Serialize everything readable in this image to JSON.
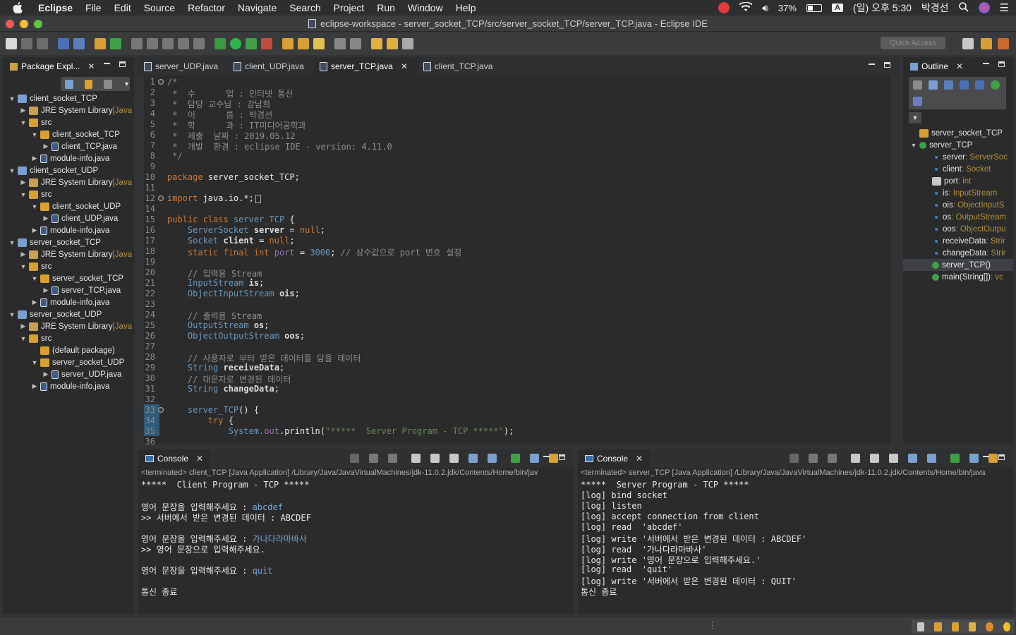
{
  "menubar": {
    "app_name": "Eclipse",
    "items": [
      "File",
      "Edit",
      "Source",
      "Refactor",
      "Navigate",
      "Search",
      "Project",
      "Run",
      "Window",
      "Help"
    ],
    "battery": "37%",
    "input_source": "A",
    "clock": "(일) 오후 5:30",
    "user": "박경선"
  },
  "window": {
    "title": "eclipse-workspace - server_socket_TCP/src/server_socket_TCP/server_TCP.java - Eclipse IDE"
  },
  "toolbar": {
    "quick_access": "Quick Access"
  },
  "package_explorer": {
    "tab_label": "Package Expl...",
    "tree": [
      {
        "label": "client_socket_TCP",
        "suffix": "",
        "arrow": "▼",
        "icon": "project-icon",
        "level": 0
      },
      {
        "label": "JRE System Library",
        "suffix": "[Java",
        "arrow": "▶",
        "icon": "library-icon",
        "level": 1
      },
      {
        "label": "src",
        "suffix": "",
        "arrow": "▼",
        "icon": "src-folder-icon",
        "level": 1
      },
      {
        "label": "client_socket_TCP",
        "suffix": "",
        "arrow": "▼",
        "icon": "package-icon",
        "level": 2
      },
      {
        "label": "client_TCP.java",
        "suffix": "",
        "arrow": "▶",
        "icon": "java-file-icon",
        "level": 3
      },
      {
        "label": "module-info.java",
        "suffix": "",
        "arrow": "▶",
        "icon": "java-file-icon",
        "level": 2
      },
      {
        "label": "client_socket_UDP",
        "suffix": "",
        "arrow": "▼",
        "icon": "project-icon",
        "level": 0
      },
      {
        "label": "JRE System Library",
        "suffix": "[Java",
        "arrow": "▶",
        "icon": "library-icon",
        "level": 1
      },
      {
        "label": "src",
        "suffix": "",
        "arrow": "▼",
        "icon": "src-folder-icon",
        "level": 1
      },
      {
        "label": "client_socket_UDP",
        "suffix": "",
        "arrow": "▼",
        "icon": "package-icon",
        "level": 2
      },
      {
        "label": "client_UDP.java",
        "suffix": "",
        "arrow": "▶",
        "icon": "java-file-icon",
        "level": 3
      },
      {
        "label": "module-info.java",
        "suffix": "",
        "arrow": "▶",
        "icon": "java-file-icon",
        "level": 2
      },
      {
        "label": "server_socket_TCP",
        "suffix": "",
        "arrow": "▼",
        "icon": "project-icon",
        "level": 0
      },
      {
        "label": "JRE System Library",
        "suffix": "[Java",
        "arrow": "▶",
        "icon": "library-icon",
        "level": 1
      },
      {
        "label": "src",
        "suffix": "",
        "arrow": "▼",
        "icon": "src-folder-icon",
        "level": 1
      },
      {
        "label": "server_socket_TCP",
        "suffix": "",
        "arrow": "▼",
        "icon": "package-icon",
        "level": 2
      },
      {
        "label": "server_TCP.java",
        "suffix": "",
        "arrow": "▶",
        "icon": "java-file-icon",
        "level": 3
      },
      {
        "label": "module-info.java",
        "suffix": "",
        "arrow": "▶",
        "icon": "java-file-icon",
        "level": 2
      },
      {
        "label": "server_socket_UDP",
        "suffix": "",
        "arrow": "▼",
        "icon": "project-icon",
        "level": 0
      },
      {
        "label": "JRE System Library",
        "suffix": "[Java",
        "arrow": "▶",
        "icon": "library-icon",
        "level": 1
      },
      {
        "label": "src",
        "suffix": "",
        "arrow": "▼",
        "icon": "src-folder-icon",
        "level": 1
      },
      {
        "label": "(default package)",
        "suffix": "",
        "arrow": "",
        "icon": "package-icon",
        "level": 2
      },
      {
        "label": "server_socket_UDP",
        "suffix": "",
        "arrow": "▼",
        "icon": "package-icon",
        "level": 2
      },
      {
        "label": "server_UDP.java",
        "suffix": "",
        "arrow": "▶",
        "icon": "java-file-icon",
        "level": 3
      },
      {
        "label": "module-info.java",
        "suffix": "",
        "arrow": "▶",
        "icon": "java-file-icon",
        "level": 2
      }
    ]
  },
  "editor": {
    "tabs": [
      "server_UDP.java",
      "client_UDP.java",
      "server_TCP.java",
      "client_TCP.java"
    ],
    "active_tab": 2,
    "lines": [
      {
        "n": "1",
        "fold": true,
        "segs": [
          {
            "c": "cm",
            "t": "/*"
          }
        ]
      },
      {
        "n": "2",
        "segs": [
          {
            "c": "cm",
            "t": " *  수      업 : 인터넷 통신"
          }
        ]
      },
      {
        "n": "3",
        "segs": [
          {
            "c": "cm",
            "t": " *  담당 교수님 : 강남희"
          }
        ]
      },
      {
        "n": "4",
        "segs": [
          {
            "c": "cm",
            "t": " *  이      름 : 박경선"
          }
        ]
      },
      {
        "n": "5",
        "segs": [
          {
            "c": "cm",
            "t": " *  학      과 : IT미디어공학과"
          }
        ]
      },
      {
        "n": "6",
        "segs": [
          {
            "c": "cm",
            "t": " *  제출  날짜 : 2019.05.12"
          }
        ]
      },
      {
        "n": "7",
        "segs": [
          {
            "c": "cm",
            "t": " *  개발  환경 : eclipse IDE - version: 4.11.0"
          }
        ]
      },
      {
        "n": "8",
        "segs": [
          {
            "c": "cm",
            "t": " */"
          }
        ]
      },
      {
        "n": "9",
        "segs": []
      },
      {
        "n": "10",
        "segs": [
          {
            "c": "kw",
            "t": "package "
          },
          {
            "c": "",
            "t": "server_socket_TCP;"
          }
        ]
      },
      {
        "n": "11",
        "segs": []
      },
      {
        "n": "12",
        "fold": true,
        "segs": [
          {
            "c": "kw",
            "t": "import "
          },
          {
            "c": "",
            "t": "java.io.*;"
          }
        ]
      },
      {
        "n": "14",
        "segs": []
      },
      {
        "n": "15",
        "segs": [
          {
            "c": "kw",
            "t": "public class "
          },
          {
            "c": "ty",
            "t": "server_TCP"
          },
          {
            "c": "",
            "t": " {"
          }
        ]
      },
      {
        "n": "16",
        "segs": [
          {
            "c": "ty",
            "t": "    ServerSocket "
          },
          {
            "c": "fdw",
            "t": "server"
          },
          {
            "c": "",
            "t": " = "
          },
          {
            "c": "kw",
            "t": "null"
          },
          {
            "c": "",
            "t": ";"
          }
        ]
      },
      {
        "n": "17",
        "segs": [
          {
            "c": "ty",
            "t": "    Socket "
          },
          {
            "c": "fdw",
            "t": "client"
          },
          {
            "c": "",
            "t": " = "
          },
          {
            "c": "kw",
            "t": "null"
          },
          {
            "c": "",
            "t": ";"
          }
        ]
      },
      {
        "n": "18",
        "segs": [
          {
            "c": "kw",
            "t": "    static final int "
          },
          {
            "c": "fd",
            "t": "port"
          },
          {
            "c": "",
            "t": " = "
          },
          {
            "c": "ty",
            "t": "3000"
          },
          {
            "c": "",
            "t": "; "
          },
          {
            "c": "cm",
            "t": "// 상수값으로 port 번호 설정"
          }
        ]
      },
      {
        "n": "19",
        "segs": []
      },
      {
        "n": "20",
        "segs": [
          {
            "c": "cm",
            "t": "    // 입력용 Stream"
          }
        ]
      },
      {
        "n": "21",
        "segs": [
          {
            "c": "ty",
            "t": "    InputStream "
          },
          {
            "c": "fdw",
            "t": "is"
          },
          {
            "c": "",
            "t": ";"
          }
        ]
      },
      {
        "n": "22",
        "segs": [
          {
            "c": "ty",
            "t": "    ObjectInputStream "
          },
          {
            "c": "fdw",
            "t": "ois"
          },
          {
            "c": "",
            "t": ";"
          }
        ]
      },
      {
        "n": "23",
        "segs": []
      },
      {
        "n": "24",
        "segs": [
          {
            "c": "cm",
            "t": "    // 출력용 Stream"
          }
        ]
      },
      {
        "n": "25",
        "segs": [
          {
            "c": "ty",
            "t": "    OutputStream "
          },
          {
            "c": "fdw",
            "t": "os"
          },
          {
            "c": "",
            "t": ";"
          }
        ]
      },
      {
        "n": "26",
        "segs": [
          {
            "c": "ty",
            "t": "    ObjectOutputStream "
          },
          {
            "c": "fdw",
            "t": "oos"
          },
          {
            "c": "",
            "t": ";"
          }
        ]
      },
      {
        "n": "27",
        "segs": []
      },
      {
        "n": "28",
        "segs": [
          {
            "c": "cm",
            "t": "    // 사용자로 부터 받은 데이터를 담을 데이터"
          }
        ]
      },
      {
        "n": "29",
        "segs": [
          {
            "c": "ty",
            "t": "    String "
          },
          {
            "c": "fdw",
            "t": "receiveData"
          },
          {
            "c": "",
            "t": ";"
          }
        ]
      },
      {
        "n": "30",
        "segs": [
          {
            "c": "cm",
            "t": "    // 대문자로 변경된 데이터"
          }
        ]
      },
      {
        "n": "31",
        "segs": [
          {
            "c": "ty",
            "t": "    String "
          },
          {
            "c": "fdw",
            "t": "changeData"
          },
          {
            "c": "",
            "t": ";"
          }
        ]
      },
      {
        "n": "32",
        "segs": []
      },
      {
        "n": "33",
        "fold": true,
        "segs": [
          {
            "c": "ty",
            "t": "    server_TCP"
          },
          {
            "c": "",
            "t": "() {"
          }
        ]
      },
      {
        "n": "34",
        "segs": [
          {
            "c": "kw",
            "t": "        try"
          },
          {
            "c": "",
            "t": " {"
          }
        ]
      },
      {
        "n": "35",
        "segs": [
          {
            "c": "ty",
            "t": "            System."
          },
          {
            "c": "fd",
            "t": "out"
          },
          {
            "c": "",
            "t": ".println("
          },
          {
            "c": "st",
            "t": "\"*****  Server Program - TCP *****\""
          },
          {
            "c": "",
            "t": ");"
          }
        ]
      },
      {
        "n": "36",
        "segs": []
      }
    ]
  },
  "outline": {
    "tab_label": "Outline",
    "items": [
      {
        "name": "server_socket_TCP",
        "type": "",
        "icon": "package-icon",
        "level": 0,
        "arrow": ""
      },
      {
        "name": "server_TCP",
        "type": "",
        "icon": "class-icon",
        "level": 0,
        "arrow": "▼"
      },
      {
        "name": "server",
        "type": " : ServerSoc",
        "icon": "field-icon",
        "level": 1,
        "arrow": ""
      },
      {
        "name": "client",
        "type": " : Socket",
        "icon": "field-icon",
        "level": 1,
        "arrow": ""
      },
      {
        "name": "port",
        "type": " : int",
        "icon": "static-field-icon",
        "level": 1,
        "arrow": ""
      },
      {
        "name": "is",
        "type": " : InputStream",
        "icon": "field-icon",
        "level": 1,
        "arrow": ""
      },
      {
        "name": "ois",
        "type": " : ObjectInputS",
        "icon": "field-icon",
        "level": 1,
        "arrow": ""
      },
      {
        "name": "os",
        "type": " : OutputStream",
        "icon": "field-icon",
        "level": 1,
        "arrow": ""
      },
      {
        "name": "oos",
        "type": " : ObjectOutpu",
        "icon": "field-icon",
        "level": 1,
        "arrow": ""
      },
      {
        "name": "receiveData",
        "type": " : Strir",
        "icon": "field-icon",
        "level": 1,
        "arrow": ""
      },
      {
        "name": "changeData",
        "type": " : Strir",
        "icon": "field-icon",
        "level": 1,
        "arrow": ""
      },
      {
        "name": "server_TCP()",
        "type": "",
        "icon": "constructor-icon",
        "level": 1,
        "arrow": ""
      },
      {
        "name": "main(String[])",
        "type": " : vc",
        "icon": "method-icon",
        "level": 1,
        "arrow": ""
      }
    ]
  },
  "console_left": {
    "tab_label": "Console",
    "terminated": "<terminated> client_TCP [Java Application] /Library/Java/JavaVirtualMachines/jdk-11.0.2.jdk/Contents/Home/bin/jav",
    "lines": [
      [
        {
          "c": "",
          "t": "*****  Client Program - TCP *****"
        }
      ],
      [],
      [
        {
          "c": "",
          "t": "영어 문장을 입력해주세요 : "
        },
        {
          "c": "inp",
          "t": "abcdef"
        }
      ],
      [
        {
          "c": "",
          "t": ">> 서버에서 받은 변경된 데이터 : ABCDEF"
        }
      ],
      [],
      [
        {
          "c": "",
          "t": "영어 문장을 입력해주세요 : "
        },
        {
          "c": "inp",
          "t": "가나다라마바사"
        }
      ],
      [
        {
          "c": "",
          "t": ">> 영어 문장으로 입력해주세요."
        }
      ],
      [],
      [
        {
          "c": "",
          "t": "영어 문장을 입력해주세요 : "
        },
        {
          "c": "inp",
          "t": "quit"
        }
      ],
      [],
      [
        {
          "c": "",
          "t": "통신 종료"
        }
      ]
    ]
  },
  "console_right": {
    "tab_label": "Console",
    "terminated": "<terminated> server_TCP [Java Application] /Library/Java/JavaVirtualMachines/jdk-11.0.2.jdk/Contents/Home/bin/java",
    "lines": [
      [
        {
          "c": "",
          "t": "*****  Server Program - TCP *****"
        }
      ],
      [
        {
          "c": "",
          "t": "[log] bind socket"
        }
      ],
      [
        {
          "c": "",
          "t": "[log] listen"
        }
      ],
      [
        {
          "c": "",
          "t": "[log] accept connection from client"
        }
      ],
      [
        {
          "c": "",
          "t": "[log] read  'abcdef'"
        }
      ],
      [
        {
          "c": "",
          "t": "[log] write '서버에서 받은 변경된 데이터 : ABCDEF'"
        }
      ],
      [
        {
          "c": "",
          "t": "[log] read  '가나다라마바사'"
        }
      ],
      [
        {
          "c": "",
          "t": "[log] write '영어 문장으로 입력해주세요.'"
        }
      ],
      [
        {
          "c": "",
          "t": "[log] read  'quit'"
        }
      ],
      [
        {
          "c": "",
          "t": "[log] write '서버에서 받은 변경된 데이터 : QUIT'"
        }
      ],
      [
        {
          "c": "",
          "t": "통신 종료"
        }
      ]
    ]
  },
  "colors": {
    "background": "#2b2b2b",
    "keyword": "#cc7832",
    "type": "#6897bb",
    "comment": "#8e8e8e",
    "field": "#9876aa",
    "string": "#6a8759"
  }
}
